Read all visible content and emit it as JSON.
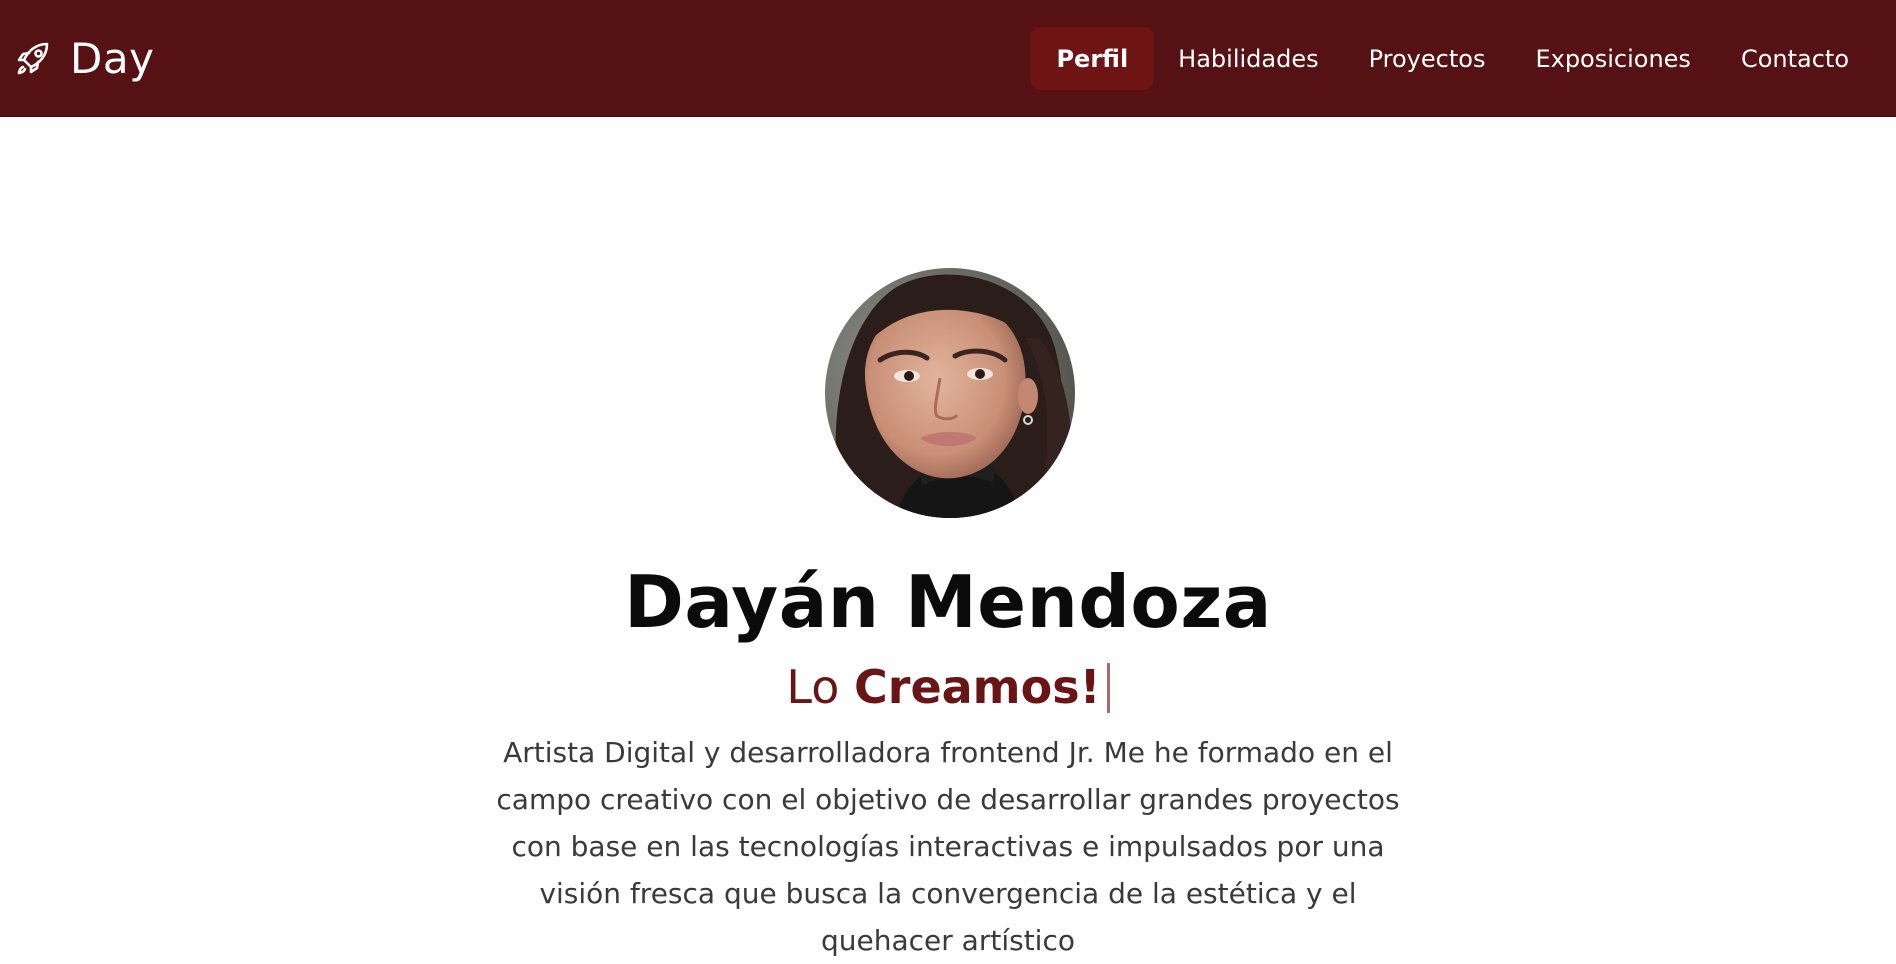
{
  "brand": {
    "icon": "rocket-icon",
    "name": "Day"
  },
  "nav": {
    "items": [
      {
        "label": "Perfil",
        "active": true
      },
      {
        "label": "Habilidades",
        "active": false
      },
      {
        "label": "Proyectos",
        "active": false
      },
      {
        "label": "Exposiciones",
        "active": false
      },
      {
        "label": "Contacto",
        "active": false
      }
    ]
  },
  "profile": {
    "avatar": "profile-photo",
    "name": "Dayán Mendoza",
    "tagline_prefix": "Lo",
    "tagline_emphasis": "Creamos!",
    "bio": "Artista Digital y desarrolladora frontend Jr. Me he formado en el campo creativo con el objetivo de desarrollar grandes proyectos con base en las tecnologías interactivas e impulsados por una visión fresca que busca la convergencia de la estética y el quehacer artístico"
  },
  "colors": {
    "navbar_bg": "#551113",
    "nav_active_bg": "#6e1414",
    "accent": "#6a1515",
    "heading": "#0b0b0b",
    "body_text": "#3a3a3a"
  }
}
